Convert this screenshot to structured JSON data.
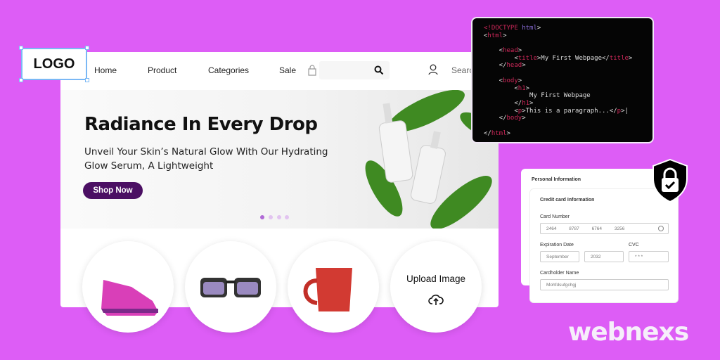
{
  "logo": {
    "label": "LOGO"
  },
  "nav": {
    "items": [
      "Home",
      "Product",
      "Categories",
      "Sale"
    ],
    "search_label": "Searc"
  },
  "hero": {
    "title": "Radiance In Every Drop",
    "subtitle": "Unveil Your Skin’s Natural Glow With Our Hydrating Glow Serum, A Lightweight",
    "cta": "Shop Now",
    "slides": 4,
    "active_slide": 1
  },
  "products": [
    {
      "icon": "sneaker"
    },
    {
      "icon": "sunglasses"
    },
    {
      "icon": "mug"
    },
    {
      "label": "Upload Image",
      "icon": "upload-icon"
    }
  ],
  "code": {
    "lines": [
      [
        [
          "t",
          "<!DOCTYPE "
        ],
        [
          "k",
          "html"
        ],
        [
          "p",
          ">"
        ]
      ],
      [
        [
          "p",
          "<"
        ],
        [
          "t",
          "html"
        ],
        [
          "p",
          ">"
        ]
      ],
      [],
      [
        [
          "p",
          "    <"
        ],
        [
          "t",
          "head"
        ],
        [
          "p",
          ">"
        ]
      ],
      [
        [
          "p",
          "        <"
        ],
        [
          "t",
          "title"
        ],
        [
          "p",
          ">My First Webpage</"
        ],
        [
          "t",
          "title"
        ],
        [
          "p",
          ">"
        ]
      ],
      [
        [
          "p",
          "    </"
        ],
        [
          "t",
          "head"
        ],
        [
          "p",
          ">"
        ]
      ],
      [],
      [
        [
          "p",
          "    <"
        ],
        [
          "t",
          "body"
        ],
        [
          "p",
          ">"
        ]
      ],
      [
        [
          "p",
          "        <"
        ],
        [
          "t",
          "h1"
        ],
        [
          "p",
          ">"
        ]
      ],
      [
        [
          "p",
          "            My First Webpage"
        ]
      ],
      [
        [
          "p",
          "        </"
        ],
        [
          "t",
          "h1"
        ],
        [
          "p",
          ">"
        ]
      ],
      [
        [
          "p",
          "        <"
        ],
        [
          "t",
          "p"
        ],
        [
          "p",
          ">This is a paragraph...</"
        ],
        [
          "t",
          "p"
        ],
        [
          "p",
          ">|"
        ]
      ],
      [
        [
          "p",
          "    </"
        ],
        [
          "t",
          "body"
        ],
        [
          "p",
          ">"
        ]
      ],
      [],
      [
        [
          "p",
          "</"
        ],
        [
          "t",
          "html"
        ],
        [
          "p",
          ">"
        ]
      ]
    ]
  },
  "form": {
    "section": "Personal Information",
    "title": "Credit card Information",
    "card_number_label": "Card Number",
    "card_number": [
      "2464",
      "8787",
      "6764",
      "3256"
    ],
    "expiration_label": "Expiration Date",
    "month": "September",
    "year": "2032",
    "cvc_label": "CVC",
    "cvc": "* * *",
    "name_label": "Cardholder Name",
    "name": "Mohfdsufgchgj"
  },
  "brand": "webnexs",
  "colors": {
    "background": "#dd5df6",
    "cta": "#4b0f63",
    "code_tag": "#d0285a"
  }
}
